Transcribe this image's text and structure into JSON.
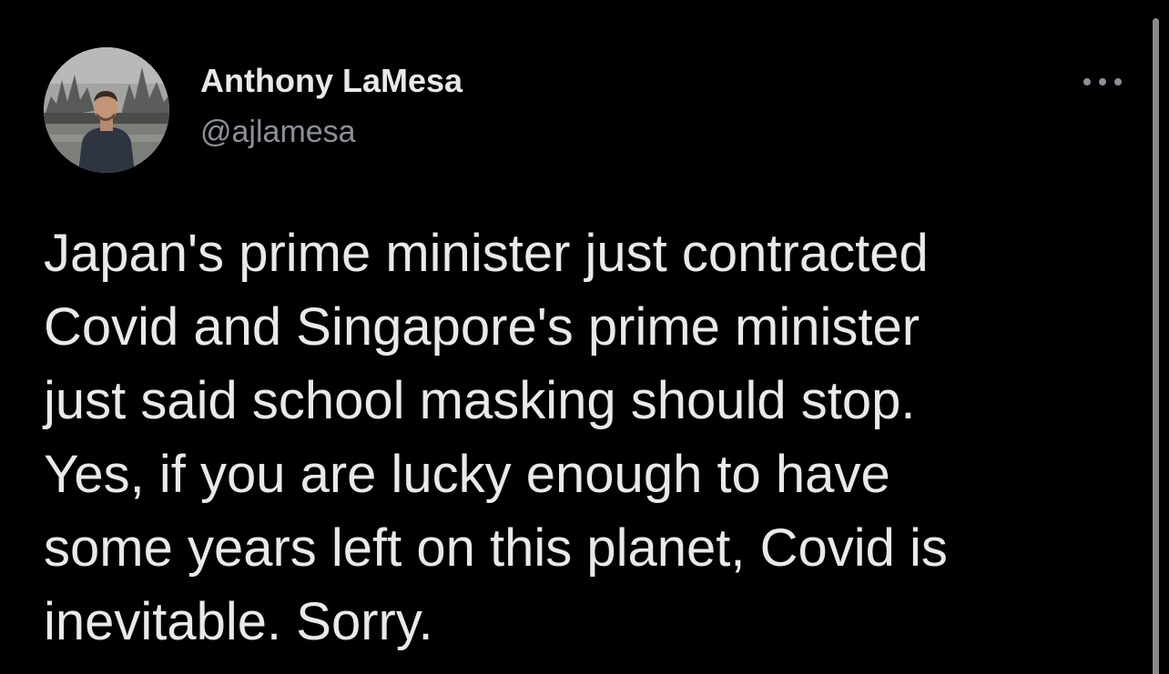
{
  "tweet": {
    "author": {
      "name": "Anthony LaMesa",
      "handle": "@ajlamesa",
      "avatar_icon": "profile-photo"
    },
    "menu_icon": "more-horizontal-icon",
    "text_lines": [
      "Japan's prime minister just contracted",
      "Covid and Singapore's prime minister",
      "just said school masking should stop.",
      "Yes, if you are lucky enough to have",
      "some years left on this planet, Covid is",
      "inevitable. Sorry."
    ]
  },
  "colors": {
    "background": "#000000",
    "text_primary": "#e7e9ea",
    "text_secondary": "#8b9197"
  }
}
